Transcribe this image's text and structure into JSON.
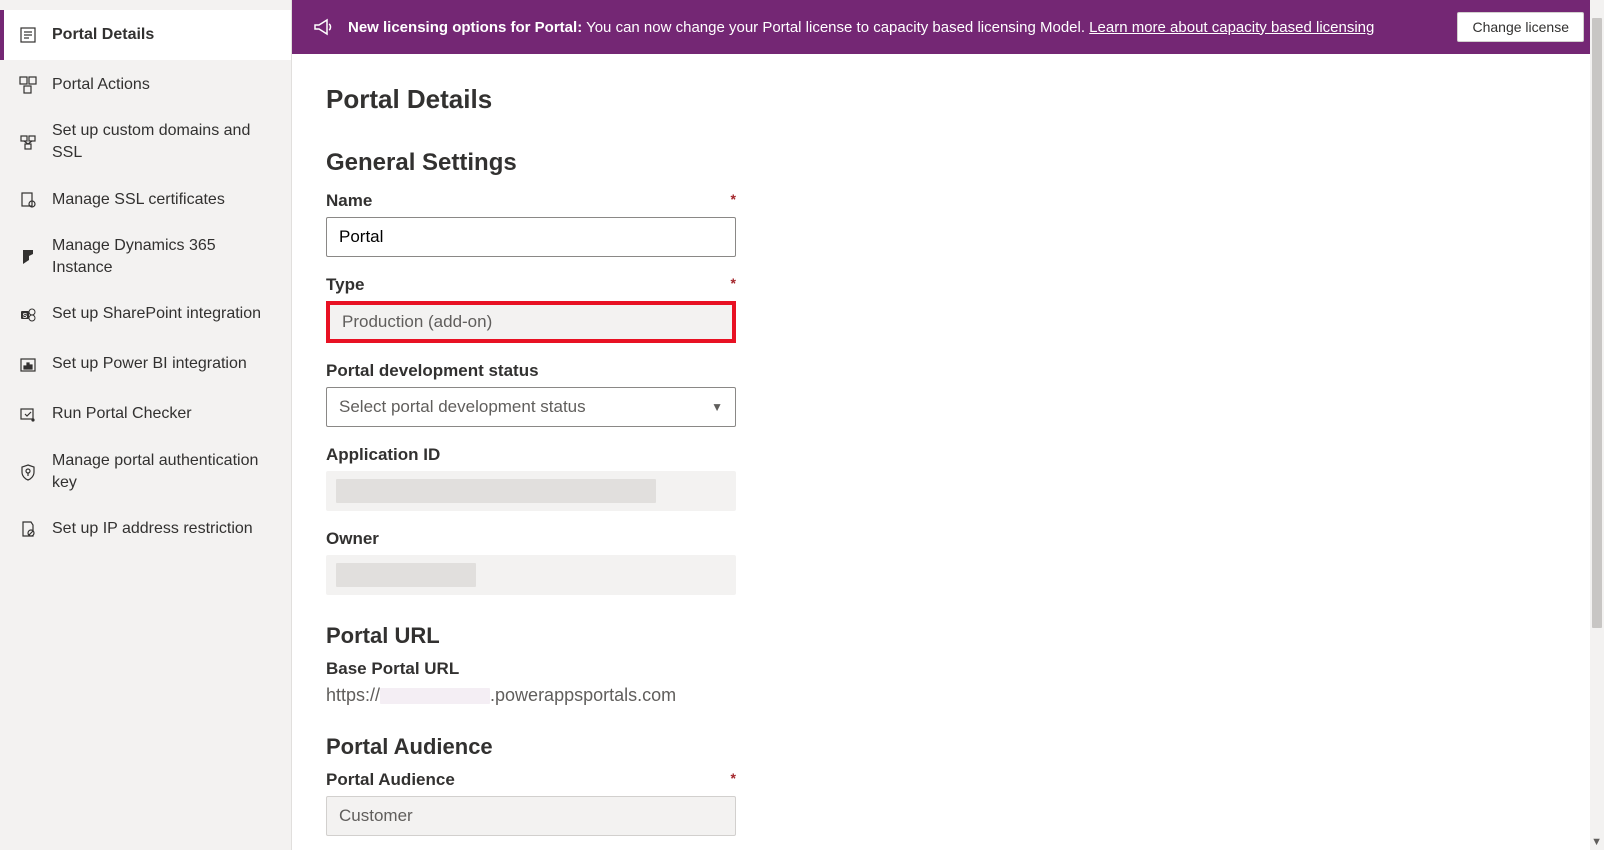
{
  "banner": {
    "bold": "New licensing options for Portal:",
    "text": " You can now change your Portal license to capacity based licensing Model. ",
    "link": "Learn more about capacity based licensing",
    "button": "Change license"
  },
  "sidebar": {
    "items": [
      {
        "label": "Portal Details",
        "active": true
      },
      {
        "label": "Portal Actions"
      },
      {
        "label": "Set up custom domains and SSL"
      },
      {
        "label": "Manage SSL certificates"
      },
      {
        "label": "Manage Dynamics 365 Instance"
      },
      {
        "label": "Set up SharePoint integration"
      },
      {
        "label": "Set up Power BI integration"
      },
      {
        "label": "Run Portal Checker"
      },
      {
        "label": "Manage portal authentication key"
      },
      {
        "label": "Set up IP address restriction"
      }
    ]
  },
  "page": {
    "title": "Portal Details",
    "general": {
      "heading": "General Settings",
      "name_label": "Name",
      "name_value": "Portal",
      "type_label": "Type",
      "type_value": "Production (add-on)",
      "status_label": "Portal development status",
      "status_placeholder": "Select portal development status",
      "appid_label": "Application ID",
      "owner_label": "Owner"
    },
    "url": {
      "heading": "Portal URL",
      "base_label": "Base Portal URL",
      "prefix": "https://",
      "suffix": ".powerappsportals.com"
    },
    "audience": {
      "heading": "Portal Audience",
      "label": "Portal Audience",
      "value": "Customer"
    }
  }
}
